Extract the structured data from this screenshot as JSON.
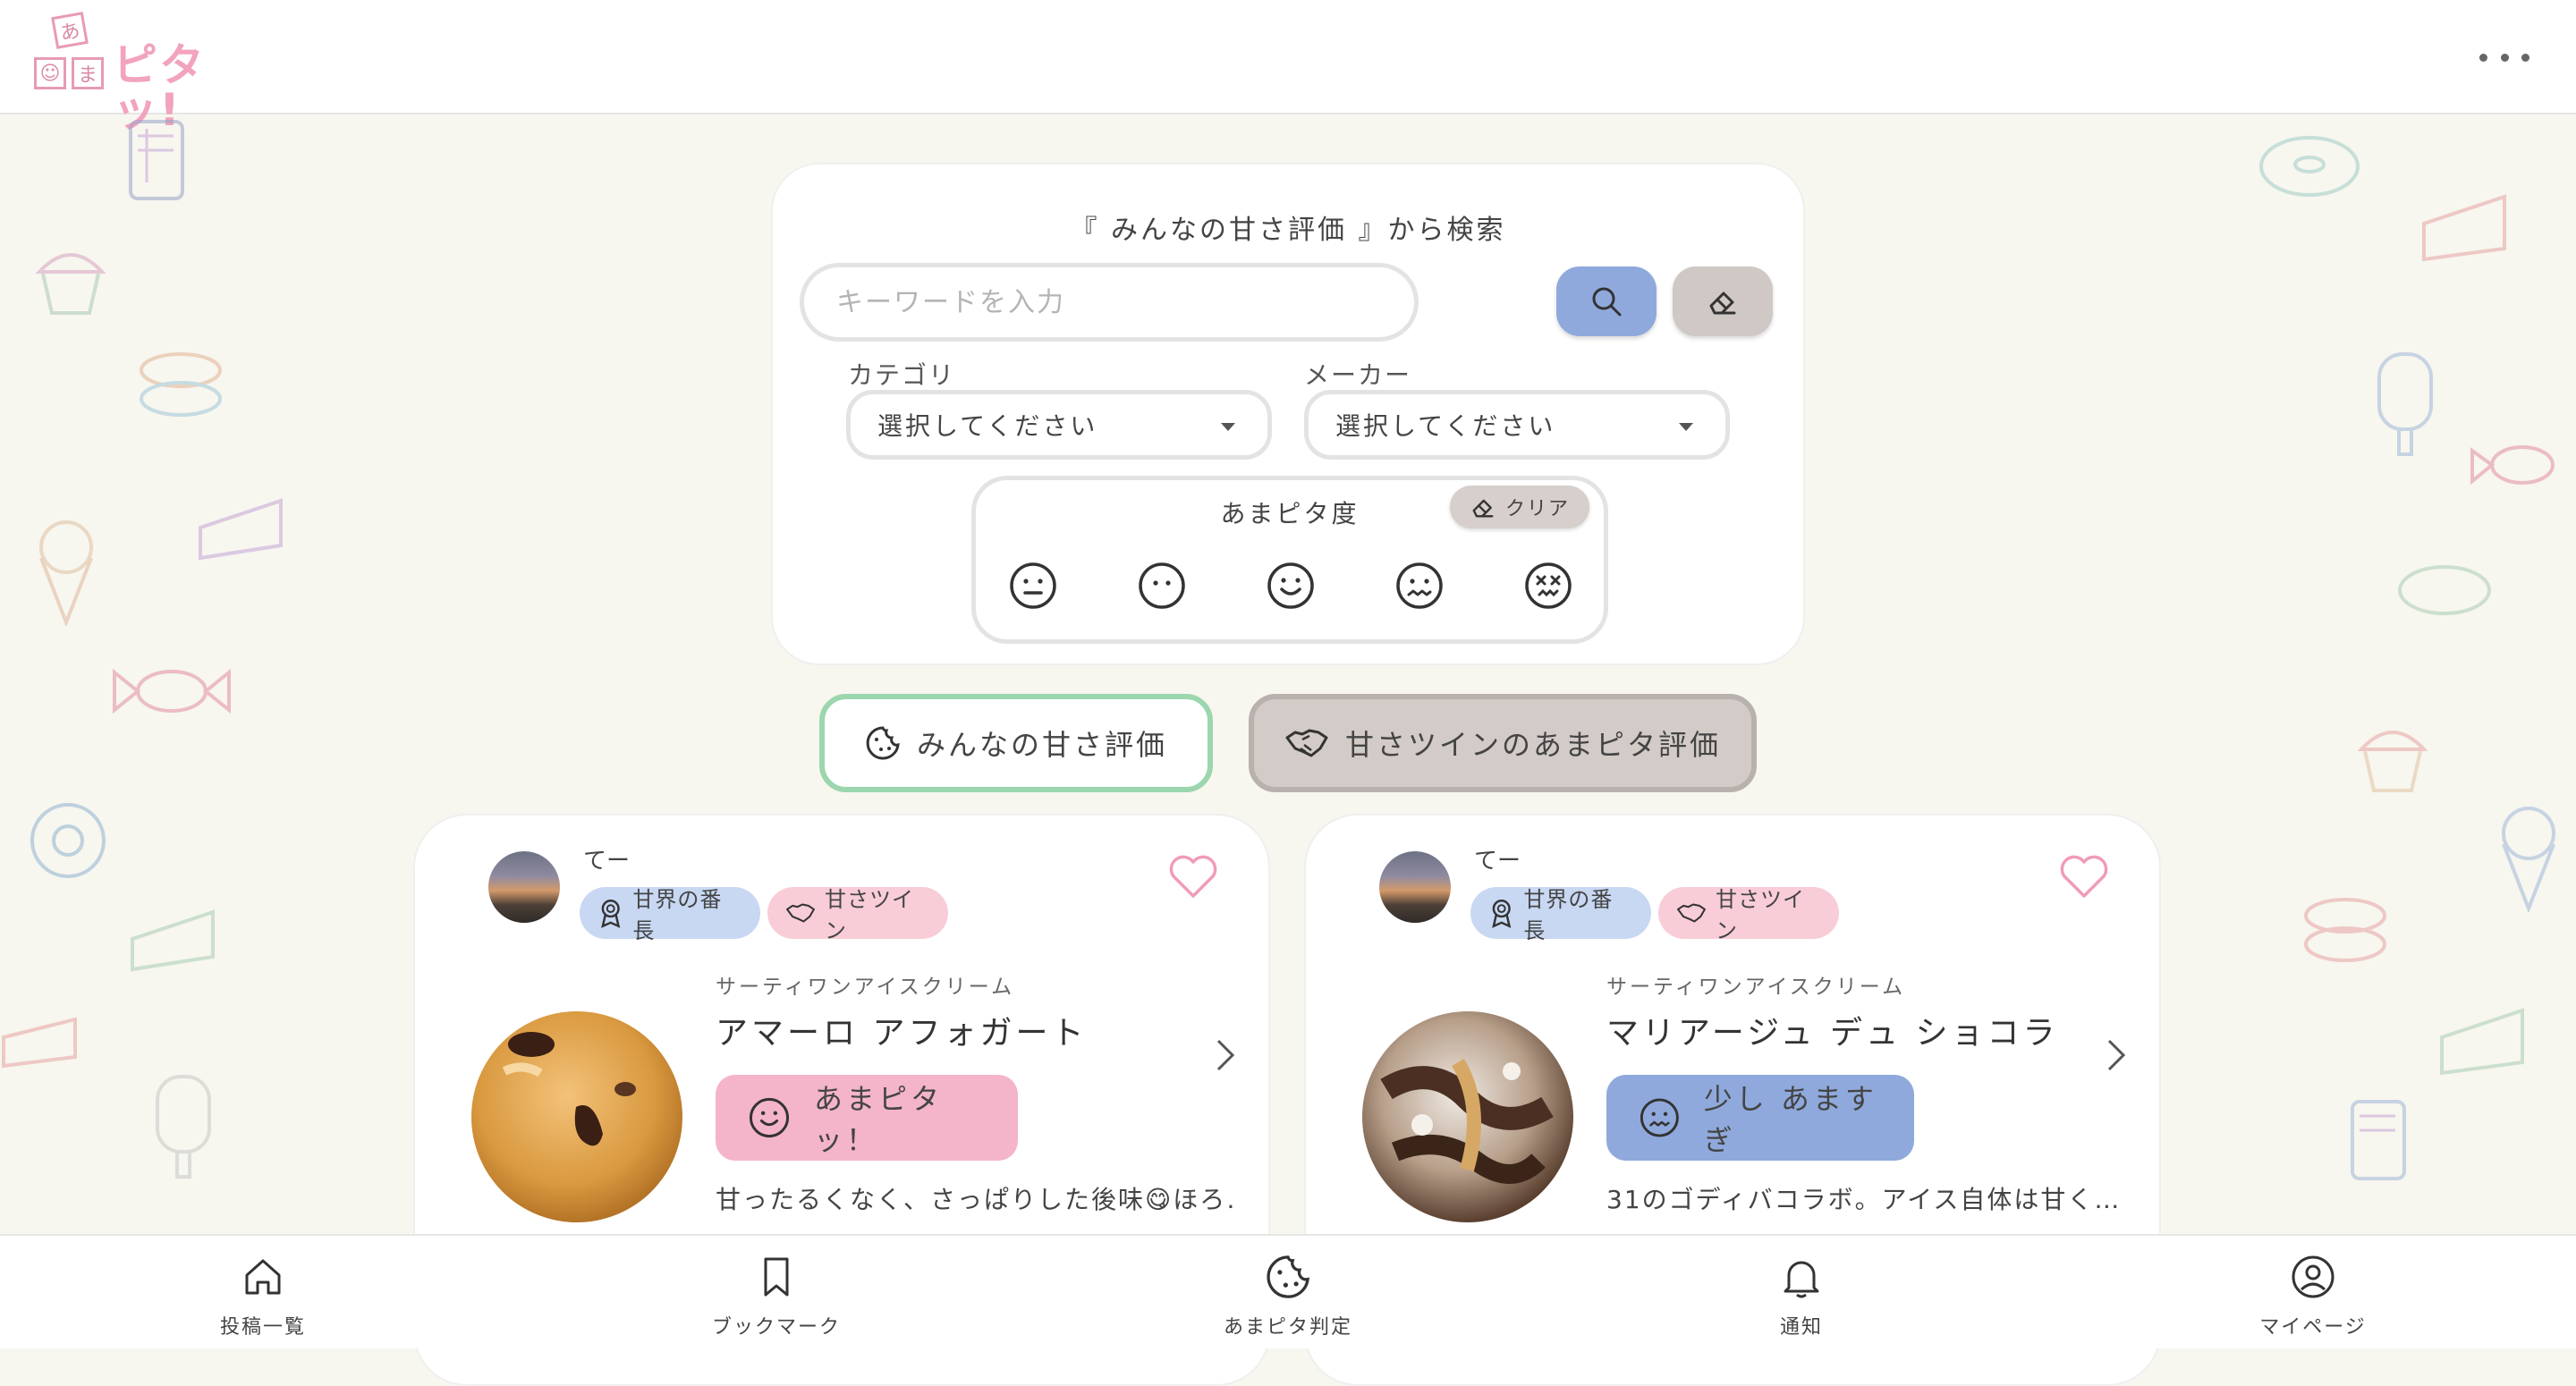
{
  "header": {
    "logo_small_chars": [
      "あ",
      "☺",
      "ま"
    ],
    "logo_text": "ピタッ!",
    "more_icon": "ellipsis-icon"
  },
  "search": {
    "title": "『 みんなの甘さ評価 』から検索",
    "placeholder": "キーワードを入力",
    "search_icon": "search-icon",
    "erase_icon": "eraser-icon",
    "category_label": "カテゴリ",
    "category_value": "選択してください",
    "maker_label": "メーカー",
    "maker_value": "選択してください",
    "amapita_label": "あまピタ度",
    "clear_label": "クリア",
    "faces": [
      "neutral-face-icon",
      "dot-eyes-face-icon",
      "smile-face-icon",
      "worried-face-icon",
      "dizzy-face-icon"
    ]
  },
  "tabs": {
    "everyone": "みんなの甘さ評価",
    "twin": "甘さツインのあまピタ評価"
  },
  "posts": [
    {
      "username": "てー",
      "badge1": "甘界の番長",
      "badge2": "甘さツイン",
      "maker": "サーティワンアイスクリーム",
      "product": "アマーロ アフォガート",
      "rating": "あまピタッ！",
      "rating_color": "#f4b4c9",
      "comment": "甘ったるくなく、さっぱりした後味😋ほろ…"
    },
    {
      "username": "てー",
      "badge1": "甘界の番長",
      "badge2": "甘さツイン",
      "maker": "サーティワンアイスクリーム",
      "product": "マリアージュ デュ ショコラ",
      "rating": "少し あますぎ",
      "rating_color": "#8fa9dc",
      "comment": "31のゴディバコラボ。アイス自体は甘く…"
    }
  ],
  "nav": {
    "home": "投稿一覧",
    "bookmark": "ブックマーク",
    "judge": "あまピタ判定",
    "notify": "通知",
    "mypage": "マイページ"
  }
}
